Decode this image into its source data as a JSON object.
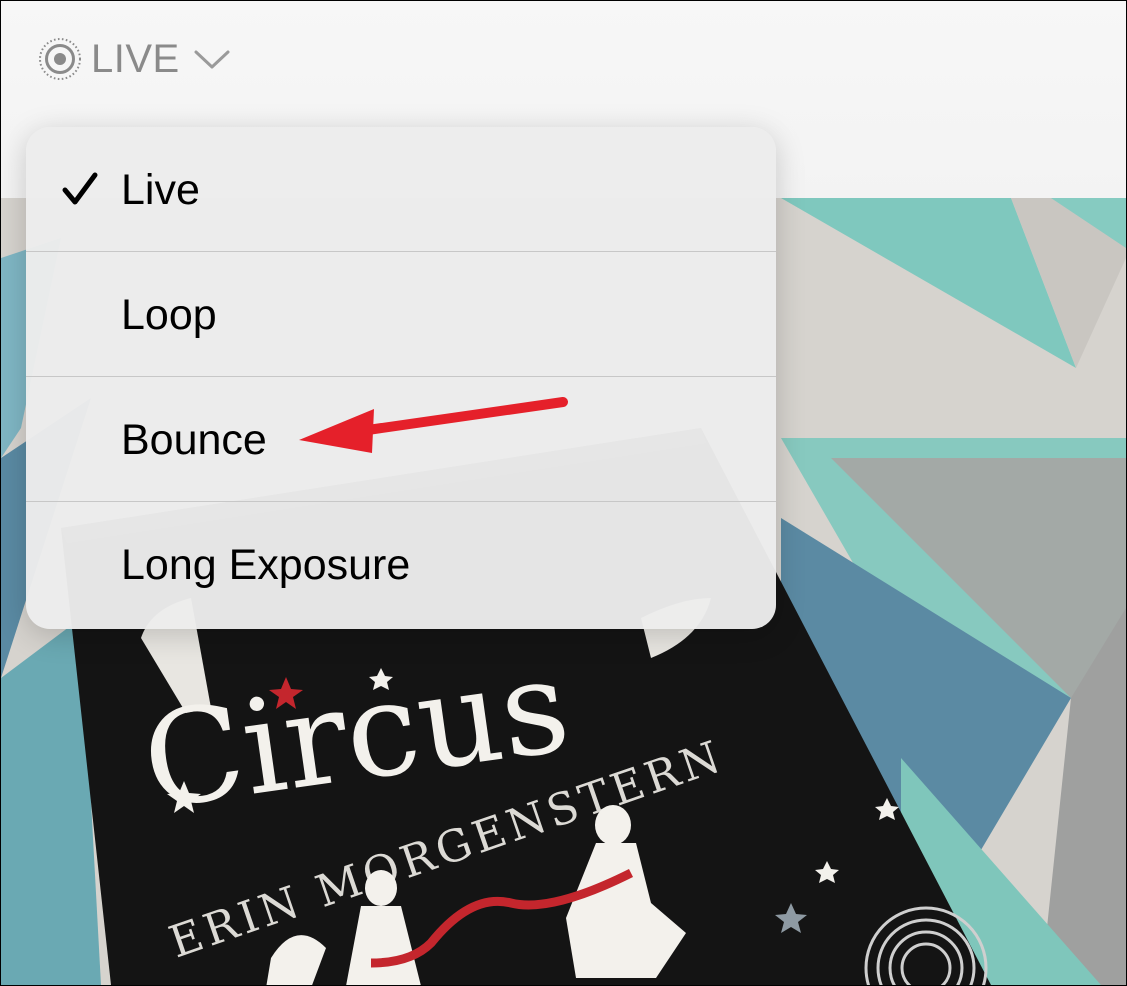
{
  "toolbar": {
    "live_icon": "live-photo-icon",
    "live_label": "LIVE",
    "chevron_icon": "chevron-down-icon"
  },
  "menu": {
    "items": [
      {
        "label": "Live",
        "checked": true
      },
      {
        "label": "Loop",
        "checked": false
      },
      {
        "label": "Bounce",
        "checked": false
      },
      {
        "label": "Long Exposure",
        "checked": false
      }
    ]
  },
  "photo": {
    "book_subtitle": "Circus",
    "book_author": "ERIN MORGENSTERN"
  },
  "annotation": {
    "arrow_color": "#e5202a",
    "points_to": "Bounce"
  }
}
